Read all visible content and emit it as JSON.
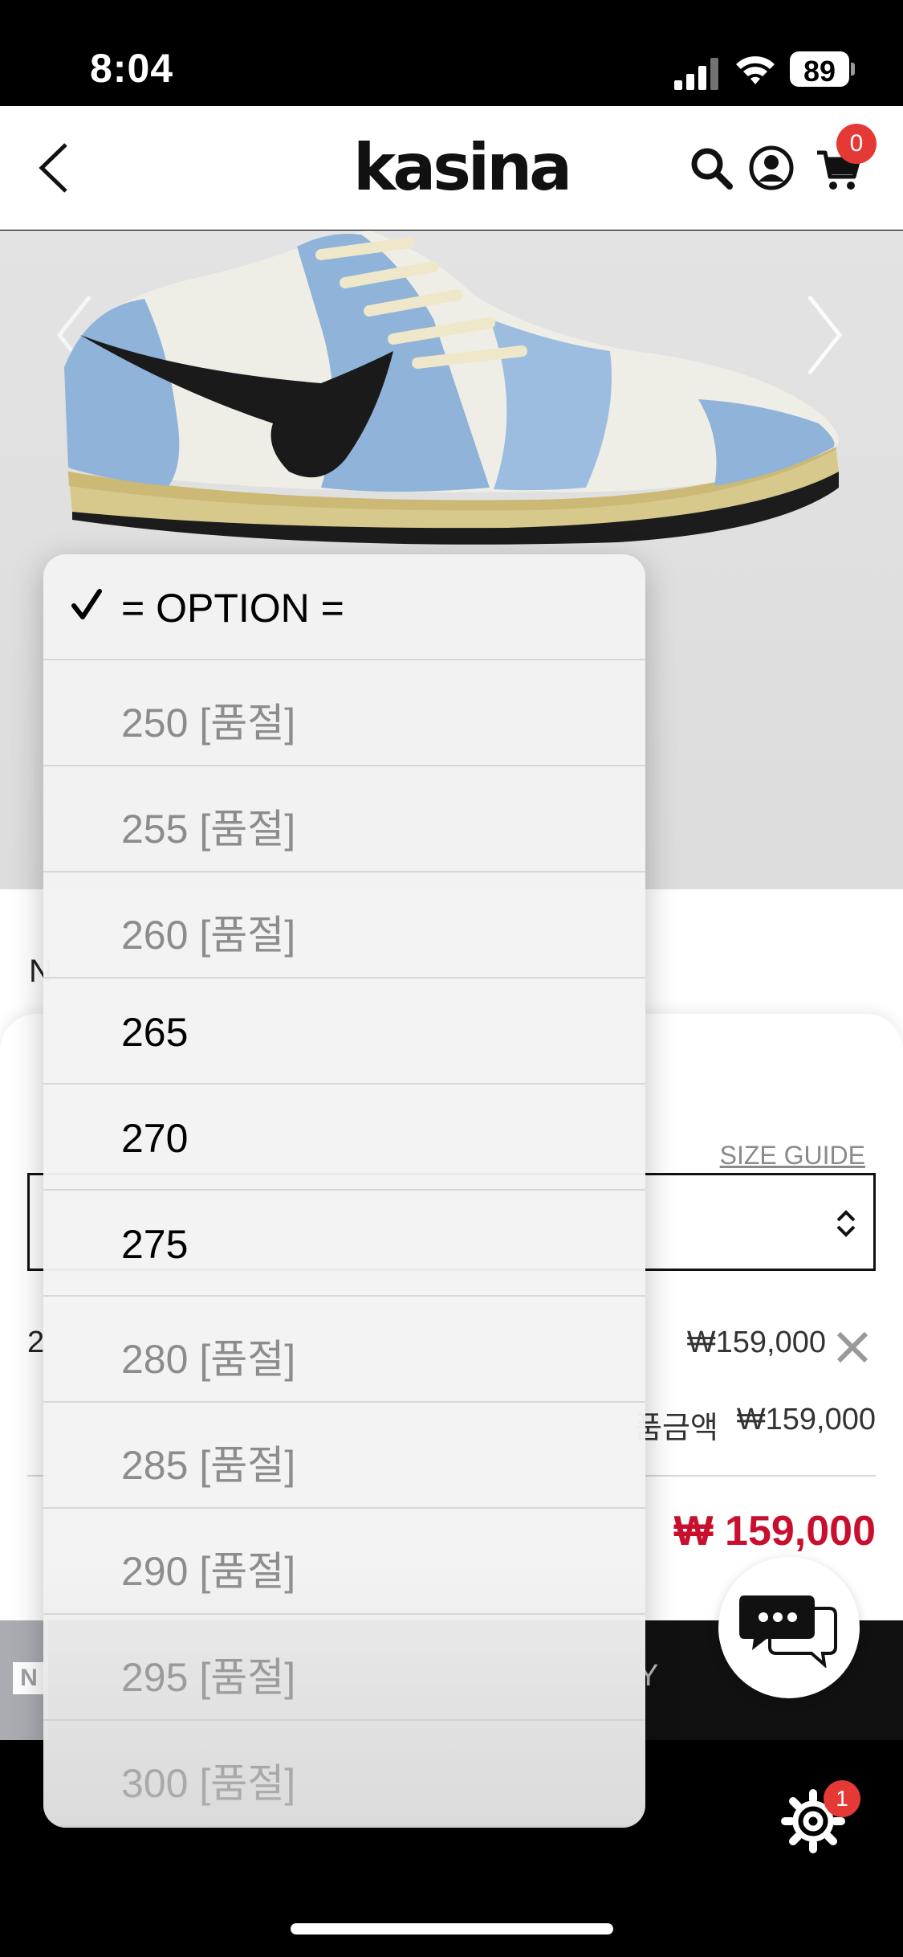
{
  "status_bar": {
    "time": "8:04",
    "battery": "89"
  },
  "header": {
    "logo": "kasina",
    "cart_count": "0"
  },
  "page": {
    "peek_letter": "N"
  },
  "sheet": {
    "size_guide": "SIZE GUIDE",
    "selected_option_prefix": "2",
    "option_price": "₩159,000",
    "subtotal_label": "품금액",
    "subtotal_price": "₩159,000",
    "total_price": "₩ 159,000"
  },
  "strip": {
    "left_letter": "N",
    "right_letter": "Y"
  },
  "nav": {
    "settings_badge": "1"
  },
  "dropdown": {
    "items": [
      {
        "label": "= OPTION =",
        "selected": true,
        "soldout": false
      },
      {
        "label": "250 [품절]",
        "selected": false,
        "soldout": true
      },
      {
        "label": "255 [품절]",
        "selected": false,
        "soldout": true
      },
      {
        "label": "260 [품절]",
        "selected": false,
        "soldout": true
      },
      {
        "label": "265",
        "selected": false,
        "soldout": false
      },
      {
        "label": "270",
        "selected": false,
        "soldout": false
      },
      {
        "label": "275",
        "selected": false,
        "soldout": false
      },
      {
        "label": "280 [품절]",
        "selected": false,
        "soldout": true
      },
      {
        "label": "285 [품절]",
        "selected": false,
        "soldout": true
      },
      {
        "label": "290 [품절]",
        "selected": false,
        "soldout": true
      },
      {
        "label": "295 [품절]",
        "selected": false,
        "soldout": true
      },
      {
        "label": "300 [품절]",
        "selected": false,
        "soldout": true
      }
    ]
  },
  "colors": {
    "accent": "#c8102e",
    "badge": "#e53935",
    "denim": "#8fb3d9"
  }
}
